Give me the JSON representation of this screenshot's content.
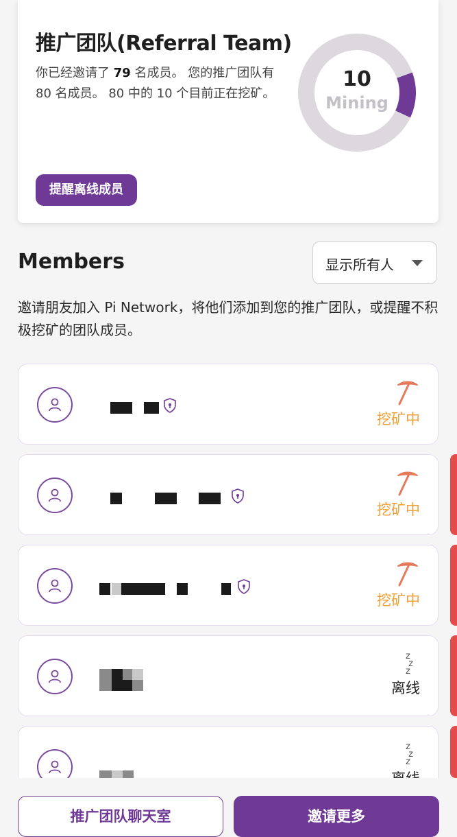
{
  "team": {
    "title": "推广团队(Referral Team)",
    "desc_part1": "你已经邀请了 ",
    "invited_count": "79",
    "desc_part2": " 名成员。 您的推广团队有 80 名成员。 80 中的 10 个目前正在挖矿。",
    "mining_count": "10",
    "mining_label": "Mining",
    "mining_fraction": 0.125,
    "remind_button": "提醒离线成员"
  },
  "members": {
    "title": "Members",
    "filter_value": "显示所有人",
    "description": "邀请朋友加入 Pi Network，将他们添加到您的推广团队，或提醒不积极挖矿的团队成员。",
    "list": [
      {
        "status": "挖矿中",
        "status_type": "mining"
      },
      {
        "status": "挖矿中",
        "status_type": "mining"
      },
      {
        "status": "挖矿中",
        "status_type": "mining"
      },
      {
        "status": "离线",
        "status_type": "offline"
      },
      {
        "status": "离线",
        "status_type": "offline"
      }
    ]
  },
  "actions": {
    "chat_button": "推广团队聊天室",
    "invite_button": "邀请更多"
  },
  "colors": {
    "brand_purple": "#6e3a96",
    "mining_orange": "#f0a038",
    "donut_track": "#dcd8de",
    "alert_red": "#e44b4b"
  },
  "icons": {
    "avatar": "user-icon",
    "verified": "shield-icon",
    "mining": "pickaxe-icon",
    "offline": "sleep-icon"
  }
}
